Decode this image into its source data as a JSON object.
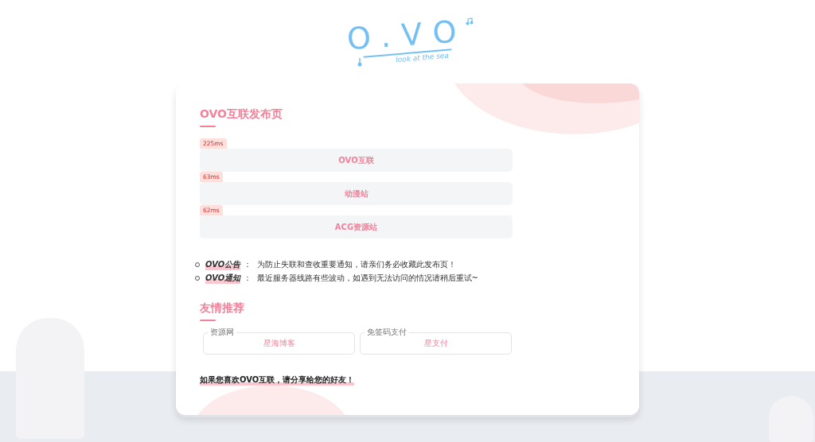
{
  "logo": {
    "title": "O.VO",
    "tagline": "look at the sea"
  },
  "card": {
    "title": "OVO互联发布页",
    "nodes": [
      {
        "latency": "225ms",
        "label": "OVO互联"
      },
      {
        "latency": "63ms",
        "label": "动漫站"
      },
      {
        "latency": "62ms",
        "label": "ACG资源站"
      }
    ],
    "notices": [
      {
        "label": "OVO公告",
        "text": "：  为防止失联和查收重要通知，请亲们务必收藏此发布页！"
      },
      {
        "label": "OVO通知",
        "text": "：  最近服务器线路有些波动，如遇到无法访问的情况请稍后重试~"
      }
    ],
    "friends_title": "友情推荐",
    "friends": [
      {
        "category": "资源网",
        "name": "星海博客"
      },
      {
        "category": "免签码支付",
        "name": "星支付"
      }
    ],
    "share": "如果您喜欢OVO互联，请分享给您的好友！"
  }
}
